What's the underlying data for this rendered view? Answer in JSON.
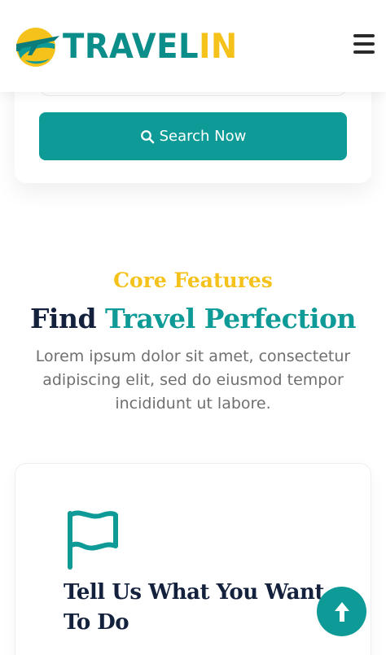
{
  "header": {
    "logo_part1": "TRAVEL",
    "logo_part2": "IN",
    "menu_icon": "hamburger-icon"
  },
  "search": {
    "button_label": "Search Now",
    "button_icon": "search-icon"
  },
  "features": {
    "kicker": "Core Features",
    "title_plain": "Find ",
    "title_accent": "Travel Perfection",
    "lead": "Lorem ipsum dolor sit amet, consectetur adipiscing elit, sed do eiusmod tempor incididunt ut labore.",
    "card": {
      "icon": "flag-icon",
      "title": "Tell Us What You Want To Do"
    }
  },
  "back_to_top_icon": "arrow-up-icon",
  "colors": {
    "primary": "#0e9a96",
    "accent": "#f4c21a",
    "heading": "#14213d",
    "body_text": "#6f6f6f"
  }
}
